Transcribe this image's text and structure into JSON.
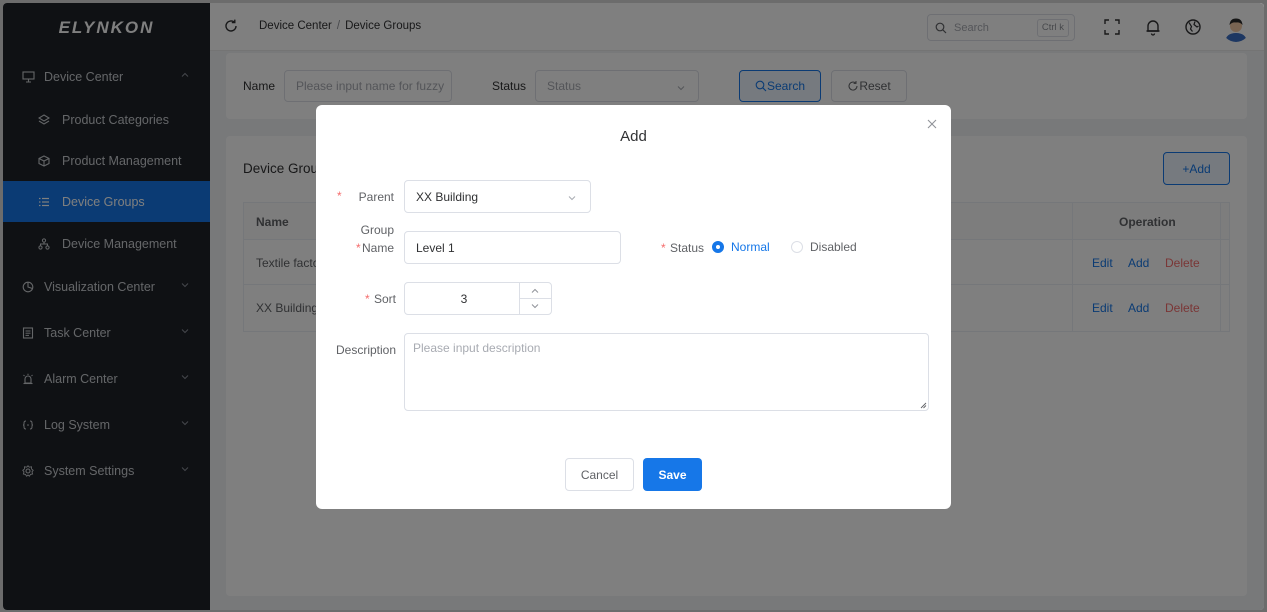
{
  "app": {
    "logo": "ELYNKON"
  },
  "sidebar": {
    "items": [
      {
        "label": "Device Center",
        "icon": "monitor-icon",
        "expanded": true
      },
      {
        "label": "Product Categories",
        "icon": "layers-icon"
      },
      {
        "label": "Product Management",
        "icon": "box-icon"
      },
      {
        "label": "Device Groups",
        "icon": "list-icon",
        "active": true
      },
      {
        "label": "Device Management",
        "icon": "hierarchy-icon"
      },
      {
        "label": "Visualization Center",
        "icon": "pie-chart-icon"
      },
      {
        "label": "Task Center",
        "icon": "clipboard-icon"
      },
      {
        "label": "Alarm Center",
        "icon": "alarm-icon"
      },
      {
        "label": "Log System",
        "icon": "code-icon"
      },
      {
        "label": "System Settings",
        "icon": "gear-icon"
      }
    ]
  },
  "header": {
    "breadcrumb": [
      "Device Center",
      "Device Groups"
    ],
    "breadcrumb_sep": "/",
    "search_placeholder": "Search",
    "search_shortcut": "Ctrl k"
  },
  "filter": {
    "name_label": "Name",
    "name_placeholder": "Please input name for fuzzy",
    "status_label": "Status",
    "status_placeholder": "Status",
    "search_button": "Search",
    "reset_button": "Reset"
  },
  "list": {
    "title": "Device Grou",
    "add_button": "+Add",
    "columns": {
      "name": "Name",
      "operation": "Operation"
    },
    "rows": [
      {
        "name": "Textile facto",
        "actions": [
          "Edit",
          "Add",
          "Delete"
        ]
      },
      {
        "name": "XX Building",
        "actions": [
          "Edit",
          "Add",
          "Delete"
        ]
      }
    ]
  },
  "modal": {
    "title": "Add",
    "required_mark": "*",
    "parent_label": "Parent",
    "parent_value": "XX Building",
    "group_name_label_line1": "Group",
    "group_name_label_line2": "Name",
    "group_name_value": "Level 1",
    "status_label": "Status",
    "status_options": [
      "Normal",
      "Disabled"
    ],
    "status_selected": "Normal",
    "sort_label": "Sort",
    "sort_value": "3",
    "description_label": "Description",
    "description_placeholder": "Please input description",
    "cancel_button": "Cancel",
    "save_button": "Save"
  },
  "colors": {
    "primary": "#1677e8",
    "danger": "#f56c6c",
    "sidebar_bg": "#1f2329",
    "overlay": "rgba(0,0,0,0.5)"
  }
}
